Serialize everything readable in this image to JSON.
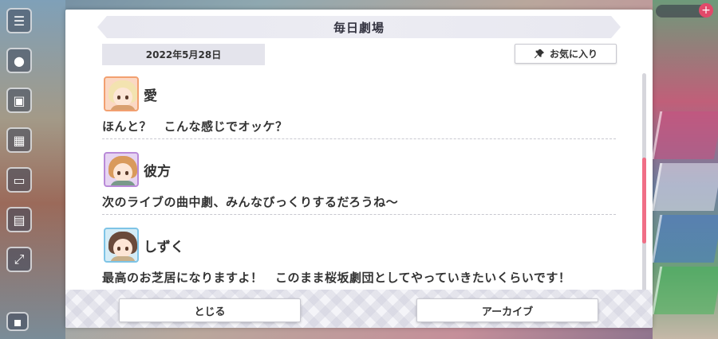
{
  "dialog": {
    "title": "毎日劇場",
    "date": "2022年5月28日",
    "favorite_label": "お気に入り",
    "entries": [
      {
        "speaker": "愛",
        "avatar": "ai-avatar",
        "line": "ほんと？　こんな感じでオッケ？"
      },
      {
        "speaker": "彼方",
        "avatar": "kanata-avatar",
        "line": "次のライブの曲中劇、みんなびっくりするだろうね～"
      },
      {
        "speaker": "しずく",
        "avatar": "shizuku-avatar",
        "line": "最高のお芝居になりますよ！　このまま桜坂劇団としてやっていきたいくらいです！"
      }
    ],
    "close_label": "とじる",
    "archive_label": "アーカイブ"
  },
  "colors": {
    "scroll_thumb": "#f06e86",
    "ai_frame": "#f2a070",
    "kanata_frame": "#b98ad8",
    "shizuku_frame": "#7ec4e6"
  }
}
